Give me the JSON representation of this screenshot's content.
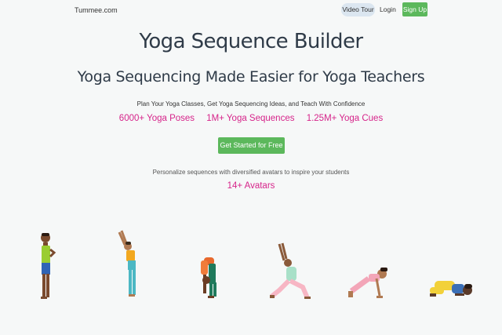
{
  "nav": {
    "brand": "Tummee.com",
    "video_tour": "Video Tour",
    "login": "Login",
    "signup": "Sign Up"
  },
  "hero": {
    "title": "Yoga Sequence Builder",
    "subtitle": "Yoga Sequencing Made Easier for Yoga Teachers",
    "tagline": "Plan Your Yoga Classes, Get Yoga Sequencing Ideas, and Teach With Confidence",
    "stats": [
      "6000+ Yoga Poses",
      "1M+ Yoga Sequences",
      "1.25M+ Yoga Cues"
    ],
    "cta": "Get Started for Free",
    "personalize": "Personalize sequences with diversified avatars to inspire your students",
    "avatars": "14+ Avatars"
  },
  "colors": {
    "accent_pink": "#d6248a",
    "button_green": "#5cb85c",
    "pill_blue": "#dbe6f0"
  },
  "illustrations": [
    "prayer-pose-figure",
    "upward-salute-figure",
    "forward-fold-figure",
    "crescent-lunge-figure",
    "plank-pose-figure",
    "child-pose-figure"
  ]
}
